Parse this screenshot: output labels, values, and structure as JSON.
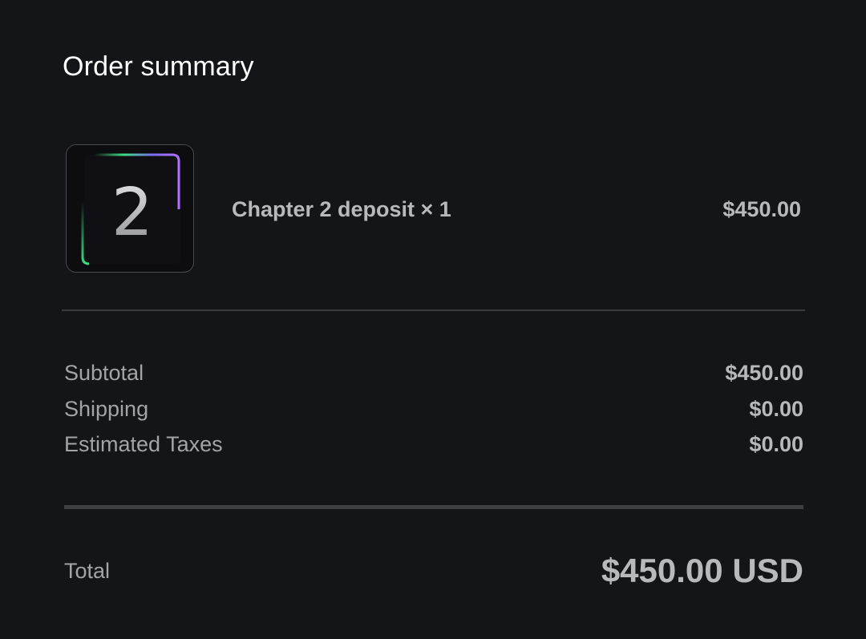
{
  "order_summary": {
    "heading": "Order summary"
  },
  "line_item": {
    "thumbnail_icon": "chapter-2-product-image",
    "thumbnail_number": "2",
    "name": "Chapter 2 deposit × 1",
    "price": "$450.00"
  },
  "summary": {
    "subtotal_label": "Subtotal",
    "subtotal_value": "$450.00",
    "shipping_label": "Shipping",
    "shipping_value": "$0.00",
    "taxes_label": "Estimated Taxes",
    "taxes_value": "$0.00"
  },
  "total": {
    "label": "Total",
    "value": "$450.00 USD"
  },
  "colors": {
    "background": "#141518",
    "heading_text": "#ffffff",
    "primary_text": "#b8b9bd",
    "secondary_text": "#a3a4a8",
    "divider": "#3b3c40",
    "accent_green": "#3ddc84",
    "accent_purple": "#8a5cf6"
  }
}
